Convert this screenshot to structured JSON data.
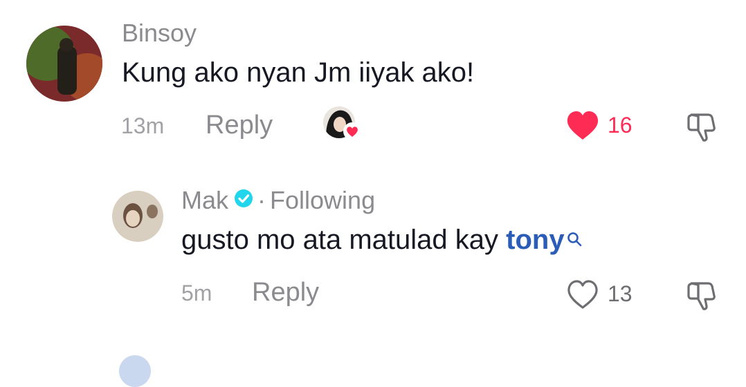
{
  "comments": [
    {
      "username": "Binsoy",
      "text": "Kung ako nyan Jm iiyak ako!",
      "time": "13m",
      "reply_label": "Reply",
      "likes": "16",
      "liked": true,
      "liked_by_creator": true,
      "like_color": "#fe2c55"
    },
    {
      "username": "Mak",
      "verified": true,
      "relation": "Following",
      "text_prefix": "gusto mo ata matulad kay ",
      "mention": "tony",
      "time": "5m",
      "reply_label": "Reply",
      "likes": "13",
      "liked": false
    }
  ],
  "icons": {
    "like": "heart-icon",
    "dislike": "thumbs-down-icon",
    "search": "search-icon",
    "verified": "verified-badge-icon"
  },
  "colors": {
    "verified": "#20d5ec",
    "mention": "#2b5db8",
    "like_active": "#fe2c55"
  }
}
